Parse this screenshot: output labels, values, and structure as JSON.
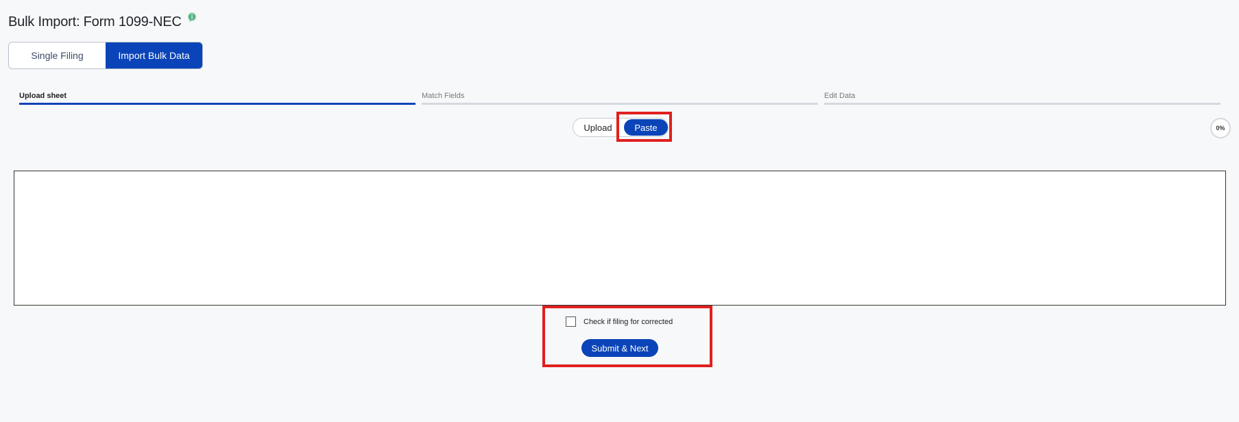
{
  "page": {
    "title": "Bulk Import: Form 1099-NEC",
    "help_icon": "info-bubble-icon"
  },
  "mode_toggle": {
    "single_label": "Single Filing",
    "bulk_label": "Import Bulk Data",
    "active": "bulk"
  },
  "stepper": {
    "steps": [
      {
        "label": "Upload sheet",
        "active": true
      },
      {
        "label": "Match Fields",
        "active": false
      },
      {
        "label": "Edit Data",
        "active": false
      }
    ]
  },
  "source_toggle": {
    "upload_label": "Upload",
    "paste_label": "Paste",
    "active": "paste"
  },
  "progress": {
    "label": "0%",
    "value": 0
  },
  "paste_area": {
    "value": "",
    "placeholder": ""
  },
  "corrected": {
    "label": "Check if filing for corrected",
    "checked": false
  },
  "submit": {
    "label": "Submit & Next"
  },
  "colors": {
    "accent": "#0a44b8",
    "background": "#f7f8fa",
    "annotation": "#e0201f",
    "help_icon": "#4caf82"
  }
}
